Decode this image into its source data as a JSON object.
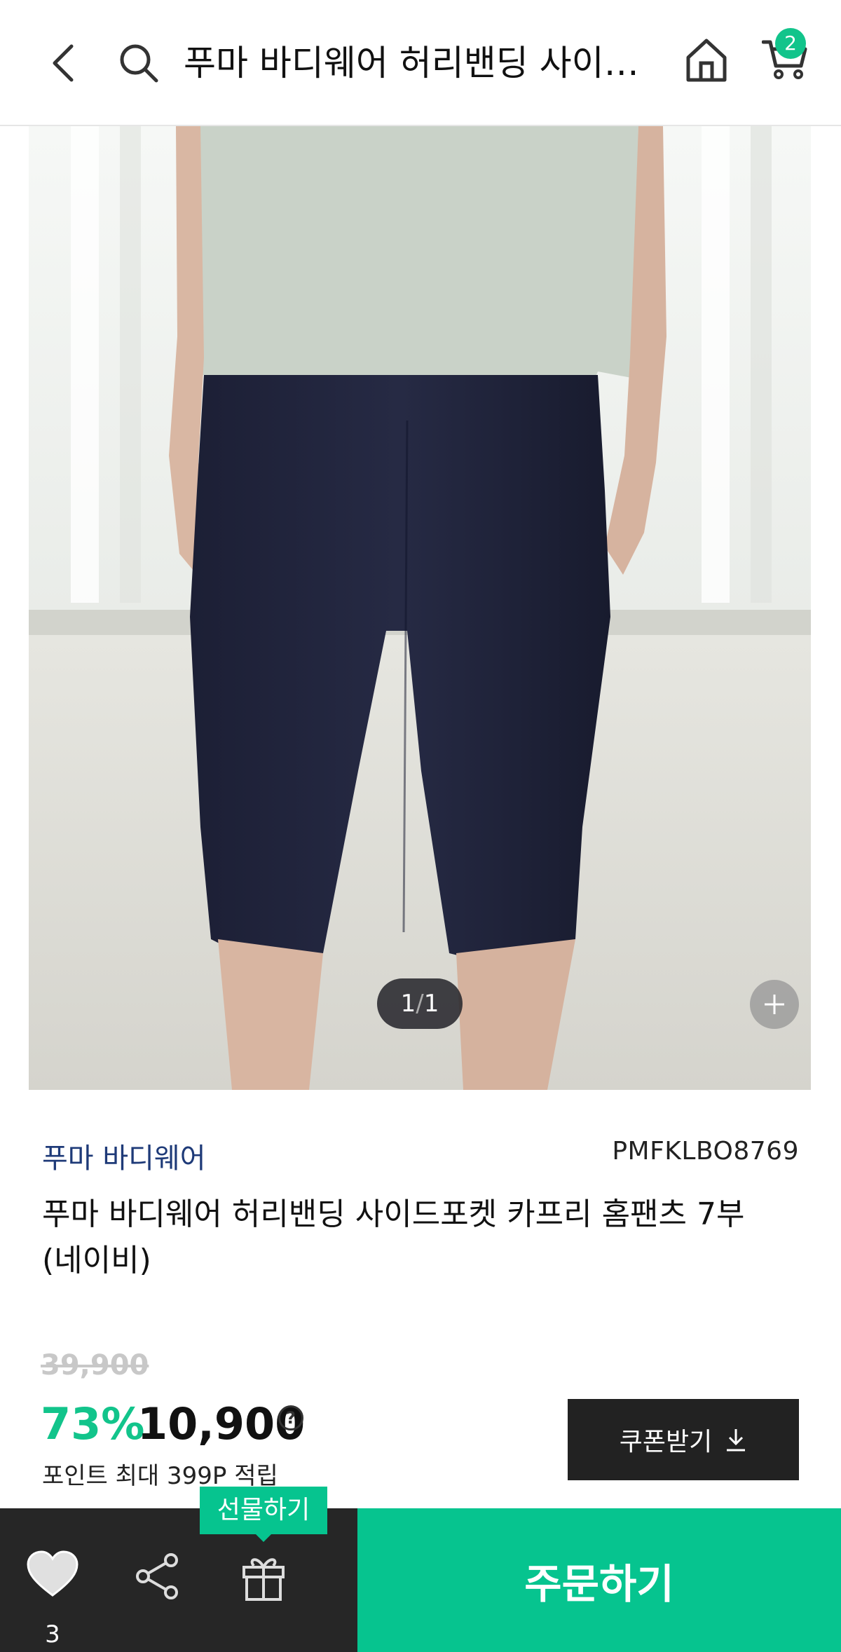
{
  "header": {
    "title": "푸마 바디웨어 허리밴딩 사이드포켓 카프리 홈팬츠 7부 (네이비)",
    "cart_count": "2"
  },
  "gallery": {
    "current": "1",
    "separator": "/",
    "total": "1"
  },
  "product": {
    "brand": "푸마 바디웨어",
    "code": "PMFKLBO8769",
    "name": "푸마 바디웨어 허리밴딩 사이드포켓 카프리 홈팬츠 7부 (네이비)",
    "original_price": "39,900",
    "discount_rate": "73%",
    "sale_price": "10,900",
    "help_icon": "?",
    "points": "포인트 최대 399P 적립"
  },
  "coupon": {
    "label": "쿠폰받기"
  },
  "bottom_bar": {
    "like_count": "3",
    "gift_tooltip": "선물하기",
    "order_label": "주문하기"
  },
  "colors": {
    "accent": "#06c48f",
    "brand_text": "#1e3a78",
    "dark_bar": "#262626"
  },
  "icons": [
    "back-arrow-icon",
    "search-icon",
    "home-icon",
    "cart-icon",
    "plus-icon",
    "heart-icon",
    "share-icon",
    "gift-icon",
    "download-icon"
  ]
}
